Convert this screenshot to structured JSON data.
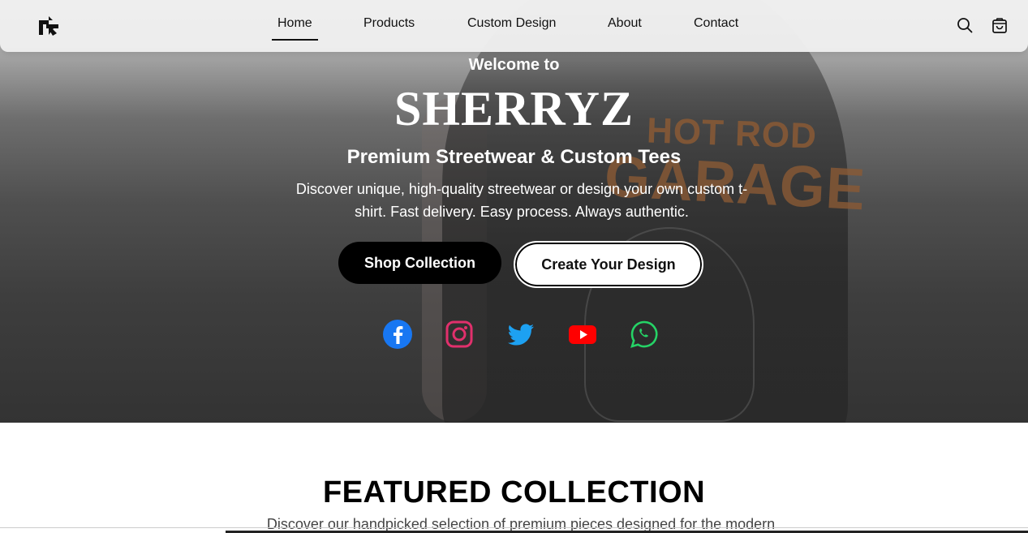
{
  "nav": {
    "logo": "logo-icon",
    "items": [
      {
        "label": "Home",
        "active": true
      },
      {
        "label": "Products",
        "active": false
      },
      {
        "label": "Custom Design",
        "active": false
      },
      {
        "label": "About",
        "active": false
      },
      {
        "label": "Contact",
        "active": false
      }
    ],
    "search_icon": "search-icon",
    "cart_icon": "shopping-bag-icon"
  },
  "hero": {
    "welcome": "Welcome to",
    "brand": "SHERRYZ",
    "tagline": "Premium Streetwear & Custom Tees",
    "description": "Discover unique, high-quality streetwear or design your own custom t-shirt. Fast delivery. Easy process. Always authentic.",
    "shirt_print_line1": "HOT ROD",
    "shirt_print_line2": "GARAGE",
    "buttons": {
      "shop": "Shop Collection",
      "create": "Create Your Design"
    },
    "social": [
      {
        "name": "facebook-icon",
        "color": "#1877F2"
      },
      {
        "name": "instagram-icon",
        "color": "#E1306C"
      },
      {
        "name": "twitter-icon",
        "color": "#1DA1F2"
      },
      {
        "name": "youtube-icon",
        "color": "#FF0000"
      },
      {
        "name": "whatsapp-icon",
        "color": "#25D366"
      }
    ]
  },
  "featured": {
    "title": "FEATURED COLLECTION",
    "subtitle": "Discover our handpicked selection of premium pieces designed for the modern"
  }
}
